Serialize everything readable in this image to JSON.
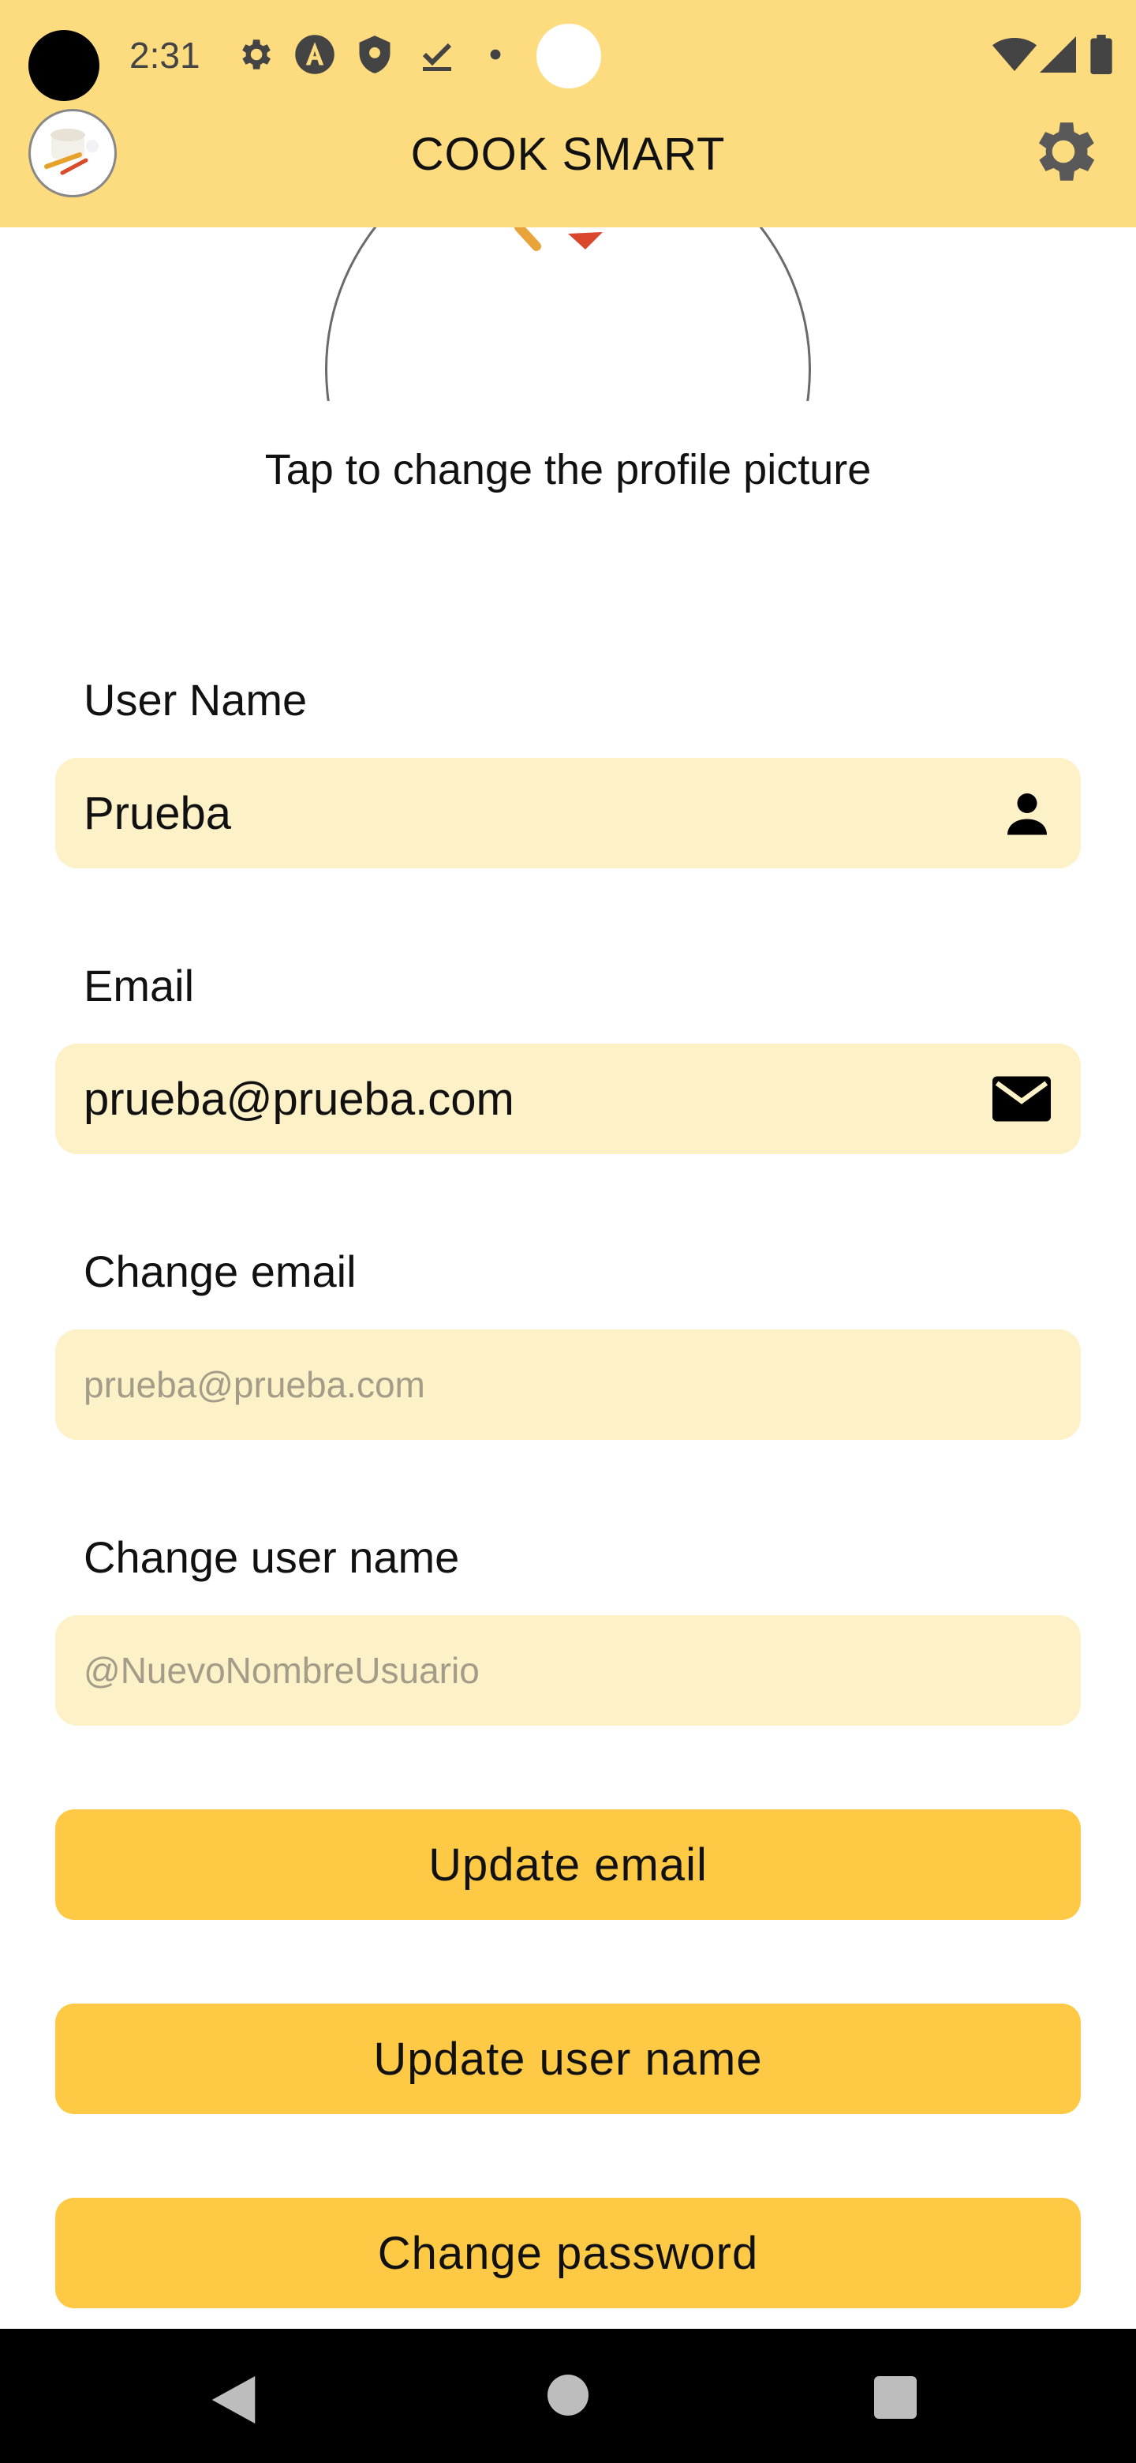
{
  "status_bar": {
    "time": "2:31",
    "icons": [
      "gear-icon",
      "app-a-icon",
      "shield-icon",
      "download-done-icon",
      "dot-icon",
      "wifi-icon",
      "cell-signal-icon",
      "battery-icon"
    ]
  },
  "app_bar": {
    "title": "COOK SMART",
    "logo_icon": "cook-smart-logo",
    "settings_icon": "gear-icon",
    "background": "#FDDC80"
  },
  "profile": {
    "tap_text": "Tap to change the profile picture"
  },
  "form": {
    "username_label": "User Name",
    "username_value": "Prueba",
    "username_icon": "person-icon",
    "email_label": "Email",
    "email_value": "prueba@prueba.com",
    "email_icon": "mail-icon",
    "change_email_label": "Change email",
    "change_email_placeholder": "prueba@prueba.com",
    "change_username_label": "Change user name",
    "change_username_placeholder": "@NuevoNombreUsuario",
    "field_background": "#FDF1C8"
  },
  "buttons": {
    "update_email": "Update email",
    "update_username": "Update user name",
    "change_password": "Change password",
    "button_color": "#FECA45"
  },
  "nav_bar": {
    "icons": [
      "back-icon",
      "home-icon",
      "recents-icon"
    ]
  }
}
